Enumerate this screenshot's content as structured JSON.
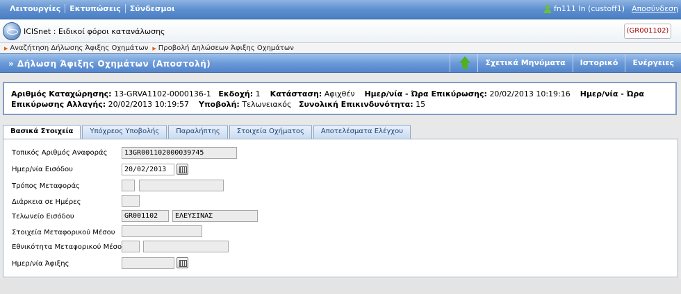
{
  "topmenu": {
    "items": [
      "Λειτουργίες",
      "Εκτυπώσεις",
      "Σύνδεσμοι"
    ]
  },
  "user": {
    "text": "fn111 In (custoff1)",
    "logout": "Αποσύνδεση"
  },
  "app": {
    "title": "ICISnet : Ειδικοί φόροι κατανάλωσης",
    "office": "(GR001102)"
  },
  "breadcrumbs": [
    "Αναζήτηση Δήλωσης Άφιξης Οχημάτων",
    "Προβολή Δηλώσεων Άφιξης Οχημάτων"
  ],
  "section": {
    "title": "» Δήλωση Άφιξης Οχημάτων (Αποστολή)",
    "actions": [
      "Σχετικά Μηνύματα",
      "Ιστορικό",
      "Ενέργειες"
    ]
  },
  "summary": {
    "reg_label": "Αριθμός Καταχώρησης:",
    "reg_value": "13-GRVA1102-0000136-1",
    "version_label": "Εκδοχή:",
    "version_value": "1",
    "status_label": "Κατάσταση:",
    "status_value": "Αφιχθέν",
    "confirm_label": "Ημερ/νία - Ώρα Επικύρωσης:",
    "confirm_value": "20/02/2013 10:19:16",
    "change_label": "Ημερ/νία - Ώρα Επικύρωσης Αλλαγής:",
    "change_value": "20/02/2013 10:19:57",
    "submit_label": "Υποβολή:",
    "submit_value": "Τελωνειακός",
    "risk_label": "Συνολική Επικινδυνότητα:",
    "risk_value": "15"
  },
  "tabs": [
    "Βασικά Στοιχεία",
    "Υπόχρεος Υποβολής",
    "Παραλήπτης",
    "Στοιχεία Οχήματος",
    "Αποτελέσματα Ελέγχου"
  ],
  "form": {
    "local_ref_label": "Τοπικός Αριθμός Αναφοράς",
    "local_ref_value": "13GR001102000039745",
    "entry_date_label": "Ημερ/νία Εισόδου",
    "entry_date_value": "20/02/2013",
    "transport_mode_label": "Τρόπος Μεταφοράς",
    "duration_label": "Διάρκεια σε Ημέρες",
    "entry_office_label": "Τελωνείο Εισόδου",
    "entry_office_code": "GR001102",
    "entry_office_name": "ΕΛΕΥΣΙΝΑΣ",
    "vehicle_info_label": "Στοιχεία Μεταφορικού Μέσου",
    "vehicle_nat_label": "Εθνικότητα Μεταφορικού Μέσου",
    "arrival_date_label": "Ημερ/νία Άφιξης"
  }
}
